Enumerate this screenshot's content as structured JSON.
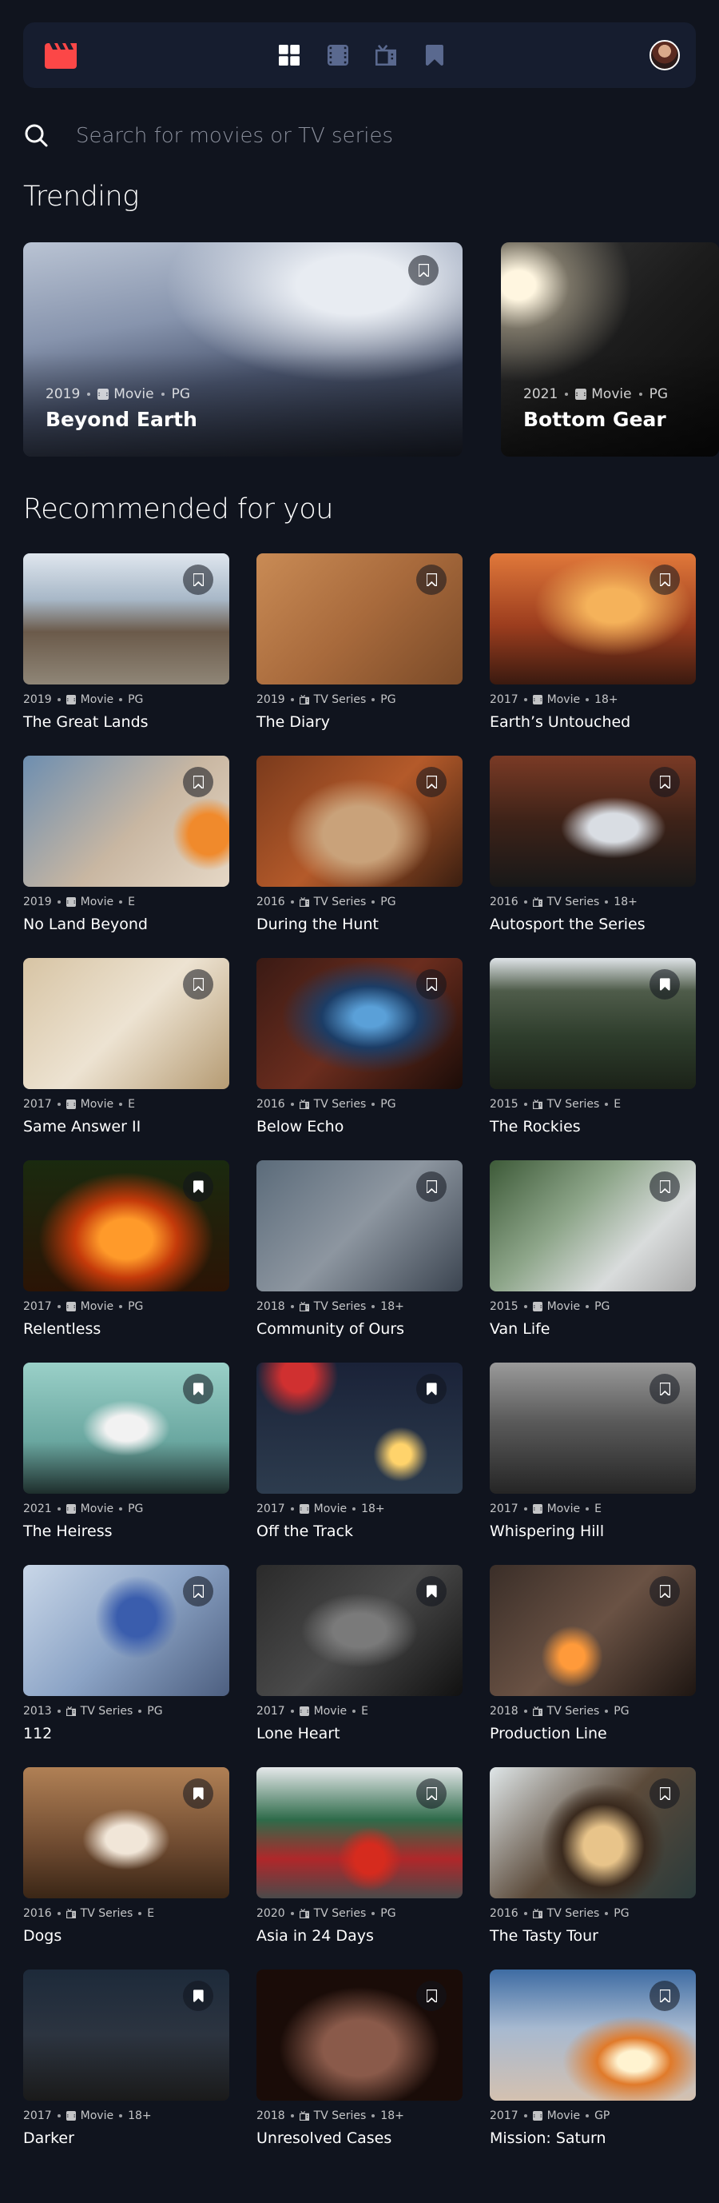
{
  "nav": {
    "logo_icon": "clapperboard-icon",
    "items": [
      {
        "name": "home",
        "icon": "grid-icon",
        "active": true
      },
      {
        "name": "movies",
        "icon": "film-icon",
        "active": false
      },
      {
        "name": "tv-series",
        "icon": "tv-icon",
        "active": false
      },
      {
        "name": "bookmarks",
        "icon": "bookmark-icon",
        "active": false
      }
    ],
    "accent_color": "#fc4747",
    "inactive_color": "#5a698f"
  },
  "search": {
    "placeholder": "Search for movies or TV series"
  },
  "trending": {
    "heading": "Trending",
    "items": [
      {
        "year": "2019",
        "category": "Movie",
        "rating": "PG",
        "title": "Beyond Earth",
        "bookmarked": false
      },
      {
        "year": "2021",
        "category": "Movie",
        "rating": "PG",
        "title": "Bottom Gear",
        "bookmarked": false
      }
    ]
  },
  "recommended": {
    "heading": "Recommended for you",
    "items": [
      {
        "year": "2019",
        "category": "Movie",
        "rating": "PG",
        "title": "The Great Lands",
        "bookmarked": false
      },
      {
        "year": "2019",
        "category": "TV Series",
        "rating": "PG",
        "title": "The Diary",
        "bookmarked": false
      },
      {
        "year": "2017",
        "category": "Movie",
        "rating": "18+",
        "title": "Earth’s Untouched",
        "bookmarked": false
      },
      {
        "year": "2019",
        "category": "Movie",
        "rating": "E",
        "title": "No Land Beyond",
        "bookmarked": false
      },
      {
        "year": "2016",
        "category": "TV Series",
        "rating": "PG",
        "title": "During the Hunt",
        "bookmarked": false
      },
      {
        "year": "2016",
        "category": "TV Series",
        "rating": "18+",
        "title": "Autosport the Series",
        "bookmarked": false
      },
      {
        "year": "2017",
        "category": "Movie",
        "rating": "E",
        "title": "Same Answer II",
        "bookmarked": false
      },
      {
        "year": "2016",
        "category": "TV Series",
        "rating": "PG",
        "title": "Below Echo",
        "bookmarked": false
      },
      {
        "year": "2015",
        "category": "TV Series",
        "rating": "E",
        "title": "The Rockies",
        "bookmarked": true
      },
      {
        "year": "2017",
        "category": "Movie",
        "rating": "PG",
        "title": "Relentless",
        "bookmarked": true
      },
      {
        "year": "2018",
        "category": "TV Series",
        "rating": "18+",
        "title": "Community of Ours",
        "bookmarked": false
      },
      {
        "year": "2015",
        "category": "Movie",
        "rating": "PG",
        "title": "Van Life",
        "bookmarked": false
      },
      {
        "year": "2021",
        "category": "Movie",
        "rating": "PG",
        "title": "The Heiress",
        "bookmarked": true
      },
      {
        "year": "2017",
        "category": "Movie",
        "rating": "18+",
        "title": "Off the Track",
        "bookmarked": true
      },
      {
        "year": "2017",
        "category": "Movie",
        "rating": "E",
        "title": "Whispering Hill",
        "bookmarked": false
      },
      {
        "year": "2013",
        "category": "TV Series",
        "rating": "PG",
        "title": "112",
        "bookmarked": false
      },
      {
        "year": "2017",
        "category": "Movie",
        "rating": "E",
        "title": "Lone Heart",
        "bookmarked": true
      },
      {
        "year": "2018",
        "category": "TV Series",
        "rating": "PG",
        "title": "Production Line",
        "bookmarked": false
      },
      {
        "year": "2016",
        "category": "TV Series",
        "rating": "E",
        "title": "Dogs",
        "bookmarked": true
      },
      {
        "year": "2020",
        "category": "TV Series",
        "rating": "PG",
        "title": "Asia in 24 Days",
        "bookmarked": false
      },
      {
        "year": "2016",
        "category": "TV Series",
        "rating": "PG",
        "title": "The Tasty Tour",
        "bookmarked": false
      },
      {
        "year": "2017",
        "category": "Movie",
        "rating": "18+",
        "title": "Darker",
        "bookmarked": true
      },
      {
        "year": "2018",
        "category": "TV Series",
        "rating": "18+",
        "title": "Unresolved Cases",
        "bookmarked": false
      },
      {
        "year": "2017",
        "category": "Movie",
        "rating": "GP",
        "title": "Mission: Saturn",
        "bookmarked": false
      }
    ]
  }
}
